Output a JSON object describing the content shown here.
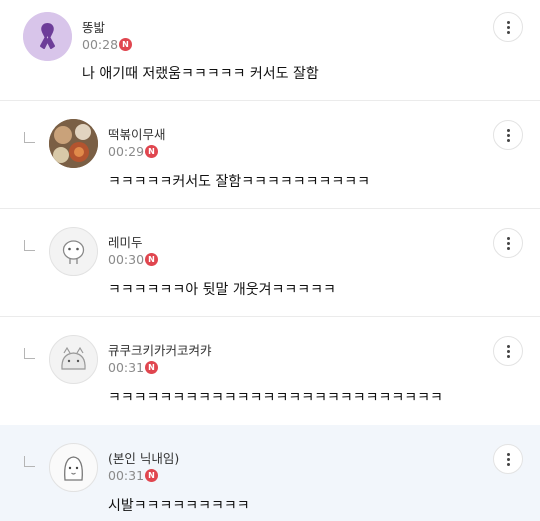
{
  "comments": [
    {
      "nickname": "똥밟",
      "time": "00:28",
      "badge": "N",
      "text": "나 애기때 저랬움ㅋㅋㅋㅋㅋ 커서도 잘함"
    },
    {
      "nickname": "떡볶이무새",
      "time": "00:29",
      "badge": "N",
      "text": "ㅋㅋㅋㅋㅋ커서도 잘함ㅋㅋㅋㅋㅋㅋㅋㅋㅋㅋ"
    },
    {
      "nickname": "레미두",
      "time": "00:30",
      "badge": "N",
      "text": "ㅋㅋㅋㅋㅋㅋ아 뒷말 개웃겨ㅋㅋㅋㅋㅋ"
    },
    {
      "nickname": "큐쿠크키카커코켜캬",
      "time": "00:31",
      "badge": "N",
      "text": "ㅋㅋㅋㅋㅋㅋㅋㅋㅋㅋㅋㅋㅋㅋㅋㅋㅋㅋㅋㅋㅋㅋㅋㅋㅋㅋ"
    },
    {
      "nickname": "(본인 닉내임)",
      "time": "00:31",
      "badge": "N",
      "text": "시발ㅋㅋㅋㅋㅋㅋㅋㅋㅋ"
    }
  ],
  "colors": {
    "highlight_bg": "#f2f6fb",
    "badge": "#e0464f",
    "divider": "#ebebeb"
  },
  "icons": {
    "more": "more-vertical-icon",
    "reply": "reply-arrow-icon",
    "badge": "new-badge-icon"
  }
}
